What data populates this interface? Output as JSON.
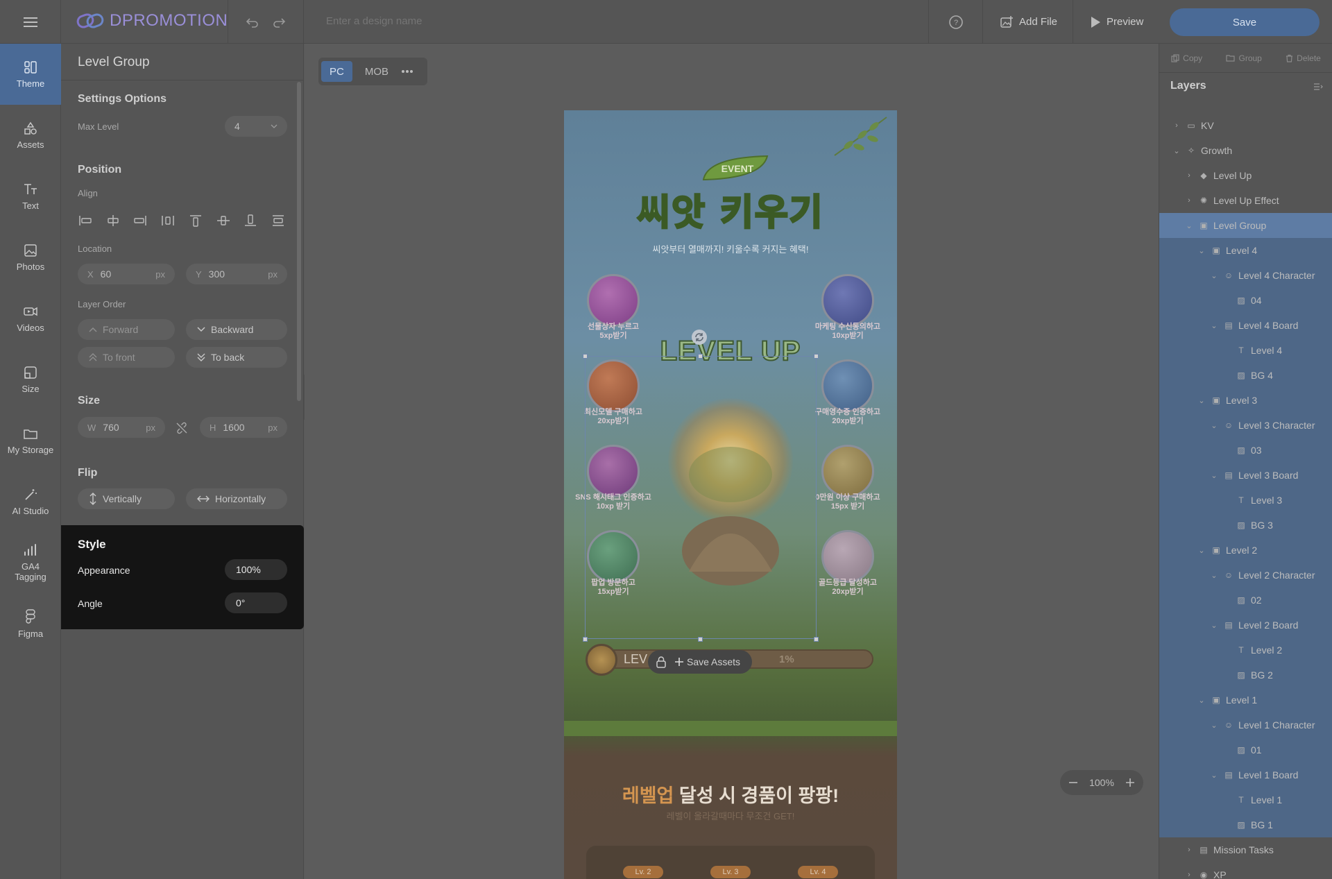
{
  "topbar": {
    "brand": "DPROMOTION",
    "design_name_placeholder": "Enter a design name",
    "add_file": "Add File",
    "preview": "Preview",
    "save": "Save"
  },
  "rail": [
    {
      "label": "Theme",
      "icon": "theme-icon"
    },
    {
      "label": "Assets",
      "icon": "assets-icon"
    },
    {
      "label": "Text",
      "icon": "text-icon"
    },
    {
      "label": "Photos",
      "icon": "photos-icon"
    },
    {
      "label": "Videos",
      "icon": "videos-icon"
    },
    {
      "label": "Size",
      "icon": "size-icon"
    },
    {
      "label": "My Storage",
      "icon": "folder-icon"
    },
    {
      "label": "AI Studio",
      "icon": "magic-wand-icon"
    },
    {
      "label": "GA4 Tagging",
      "icon": "analytics-icon"
    },
    {
      "label": "Figma",
      "icon": "figma-icon"
    }
  ],
  "panel": {
    "title": "Level Group",
    "settings": {
      "title": "Settings Options",
      "max_level_label": "Max Level",
      "max_level_value": "4"
    },
    "position": {
      "title": "Position",
      "align_label": "Align",
      "location_label": "Location",
      "x_prefix": "X",
      "x_value": "60",
      "y_prefix": "Y",
      "y_value": "300",
      "unit": "px",
      "layer_order_label": "Layer Order",
      "forward": "Forward",
      "backward": "Backward",
      "to_front": "To front",
      "to_back": "To back"
    },
    "size": {
      "title": "Size",
      "w_prefix": "W",
      "w_value": "760",
      "h_prefix": "H",
      "h_value": "1600",
      "unit": "px"
    },
    "flip": {
      "title": "Flip",
      "vertically": "Vertically",
      "horizontally": "Horizontally"
    },
    "style": {
      "title": "Style",
      "appearance_label": "Appearance",
      "appearance_value": "100%",
      "angle_label": "Angle",
      "angle_value": "0°"
    }
  },
  "canvas": {
    "device_pc": "PC",
    "device_mob": "MOB",
    "save_assets": "Save Assets",
    "zoom_value": "100%"
  },
  "artboard": {
    "event_tag": "EVENT",
    "title": "씨앗 키우기",
    "subtitle": "씨앗부터 열매까지! 키울수록 커지는 혜택!",
    "level_up": "LEVEL UP",
    "missions_left": [
      {
        "line1": "선물상자 누르고",
        "line2": "5xp받기"
      },
      {
        "line1": "최신모델 구매하고",
        "line2": "20xp받기"
      },
      {
        "line1": "SNS 해시태그 인증하고",
        "line2": "10xp 받기"
      },
      {
        "line1": "팝업 방문하고",
        "line2": "15xp받기"
      }
    ],
    "missions_right": [
      {
        "line1": "마케팅 수신동의하고",
        "line2": "10xp받기"
      },
      {
        "line1": "구매영수증 인증하고",
        "line2": "20xp받기"
      },
      {
        "line1": "0만원 이상 구매하고",
        "line2": "15px 받기"
      },
      {
        "line1": "골드등급 달성하고",
        "line2": "20xp받기"
      }
    ],
    "level_bar_label": "LEV",
    "level_bar_percent": "1%",
    "prize_title_highlight": "레벨업",
    "prize_title_rest": " 달성 시 경품이 팡팡!",
    "prize_subtitle": "레벨이 올라갈때마다 무조건 GET!",
    "prize_levels": [
      "Lv. 2",
      "Lv. 3",
      "Lv. 4"
    ]
  },
  "layers": {
    "tools": {
      "copy": "Copy",
      "group": "Group",
      "delete": "Delete"
    },
    "title": "Layers",
    "items": [
      {
        "label": "KV",
        "indent": 0,
        "chev": "›",
        "icon": "folder-icon",
        "glyph": "▭",
        "state": ""
      },
      {
        "label": "Growth",
        "indent": 0,
        "chev": "⌄",
        "icon": "sparkle-icon",
        "glyph": "✧",
        "state": ""
      },
      {
        "label": "Level Up",
        "indent": 1,
        "chev": "›",
        "icon": "badge-icon",
        "glyph": "◆",
        "state": ""
      },
      {
        "label": "Level Up Effect",
        "indent": 1,
        "chev": "›",
        "icon": "effect-icon",
        "glyph": "✺",
        "state": ""
      },
      {
        "label": "Level Group",
        "indent": 1,
        "chev": "⌄",
        "icon": "group-icon",
        "glyph": "▣",
        "state": "sel"
      },
      {
        "label": "Level 4",
        "indent": 2,
        "chev": "⌄",
        "icon": "group-icon",
        "glyph": "▣",
        "state": "hl"
      },
      {
        "label": "Level 4 Character",
        "indent": 3,
        "chev": "⌄",
        "icon": "character-icon",
        "glyph": "☺",
        "state": "hl"
      },
      {
        "label": "04",
        "indent": 4,
        "chev": "",
        "icon": "image-icon",
        "glyph": "▨",
        "state": "hl"
      },
      {
        "label": "Level 4 Board",
        "indent": 3,
        "chev": "⌄",
        "icon": "board-icon",
        "glyph": "▤",
        "state": "hl"
      },
      {
        "label": "Level 4",
        "indent": 4,
        "chev": "",
        "icon": "text-icon",
        "glyph": "T",
        "state": "hl"
      },
      {
        "label": "BG 4",
        "indent": 4,
        "chev": "",
        "icon": "image-icon",
        "glyph": "▨",
        "state": "hl"
      },
      {
        "label": "Level 3",
        "indent": 2,
        "chev": "⌄",
        "icon": "group-icon",
        "glyph": "▣",
        "state": "hl"
      },
      {
        "label": "Level 3 Character",
        "indent": 3,
        "chev": "⌄",
        "icon": "character-icon",
        "glyph": "☺",
        "state": "hl"
      },
      {
        "label": "03",
        "indent": 4,
        "chev": "",
        "icon": "image-icon",
        "glyph": "▨",
        "state": "hl"
      },
      {
        "label": "Level 3 Board",
        "indent": 3,
        "chev": "⌄",
        "icon": "board-icon",
        "glyph": "▤",
        "state": "hl"
      },
      {
        "label": "Level 3",
        "indent": 4,
        "chev": "",
        "icon": "text-icon",
        "glyph": "T",
        "state": "hl"
      },
      {
        "label": "BG 3",
        "indent": 4,
        "chev": "",
        "icon": "image-icon",
        "glyph": "▨",
        "state": "hl"
      },
      {
        "label": "Level 2",
        "indent": 2,
        "chev": "⌄",
        "icon": "group-icon",
        "glyph": "▣",
        "state": "hl"
      },
      {
        "label": "Level 2 Character",
        "indent": 3,
        "chev": "⌄",
        "icon": "character-icon",
        "glyph": "☺",
        "state": "hl"
      },
      {
        "label": "02",
        "indent": 4,
        "chev": "",
        "icon": "image-icon",
        "glyph": "▨",
        "state": "hl"
      },
      {
        "label": "Level 2 Board",
        "indent": 3,
        "chev": "⌄",
        "icon": "board-icon",
        "glyph": "▤",
        "state": "hl"
      },
      {
        "label": "Level 2",
        "indent": 4,
        "chev": "",
        "icon": "text-icon",
        "glyph": "T",
        "state": "hl"
      },
      {
        "label": "BG 2",
        "indent": 4,
        "chev": "",
        "icon": "image-icon",
        "glyph": "▨",
        "state": "hl"
      },
      {
        "label": "Level 1",
        "indent": 2,
        "chev": "⌄",
        "icon": "group-icon",
        "glyph": "▣",
        "state": "hl"
      },
      {
        "label": "Level 1 Character",
        "indent": 3,
        "chev": "⌄",
        "icon": "character-icon",
        "glyph": "☺",
        "state": "hl"
      },
      {
        "label": "01",
        "indent": 4,
        "chev": "",
        "icon": "image-icon",
        "glyph": "▨",
        "state": "hl"
      },
      {
        "label": "Level 1 Board",
        "indent": 3,
        "chev": "⌄",
        "icon": "board-icon",
        "glyph": "▤",
        "state": "hl"
      },
      {
        "label": "Level 1",
        "indent": 4,
        "chev": "",
        "icon": "text-icon",
        "glyph": "T",
        "state": "hl"
      },
      {
        "label": "BG 1",
        "indent": 4,
        "chev": "",
        "icon": "image-icon",
        "glyph": "▨",
        "state": "hl"
      },
      {
        "label": "Mission Tasks",
        "indent": 1,
        "chev": "›",
        "icon": "board-icon",
        "glyph": "▤",
        "state": ""
      },
      {
        "label": "XP",
        "indent": 1,
        "chev": "›",
        "icon": "xp-icon",
        "glyph": "◉",
        "state": ""
      }
    ]
  },
  "colors": {
    "accent": "#4a6a96",
    "layer_selected": "#5e7ca4",
    "layer_child": "#4e6787",
    "style_card": "#141414"
  }
}
